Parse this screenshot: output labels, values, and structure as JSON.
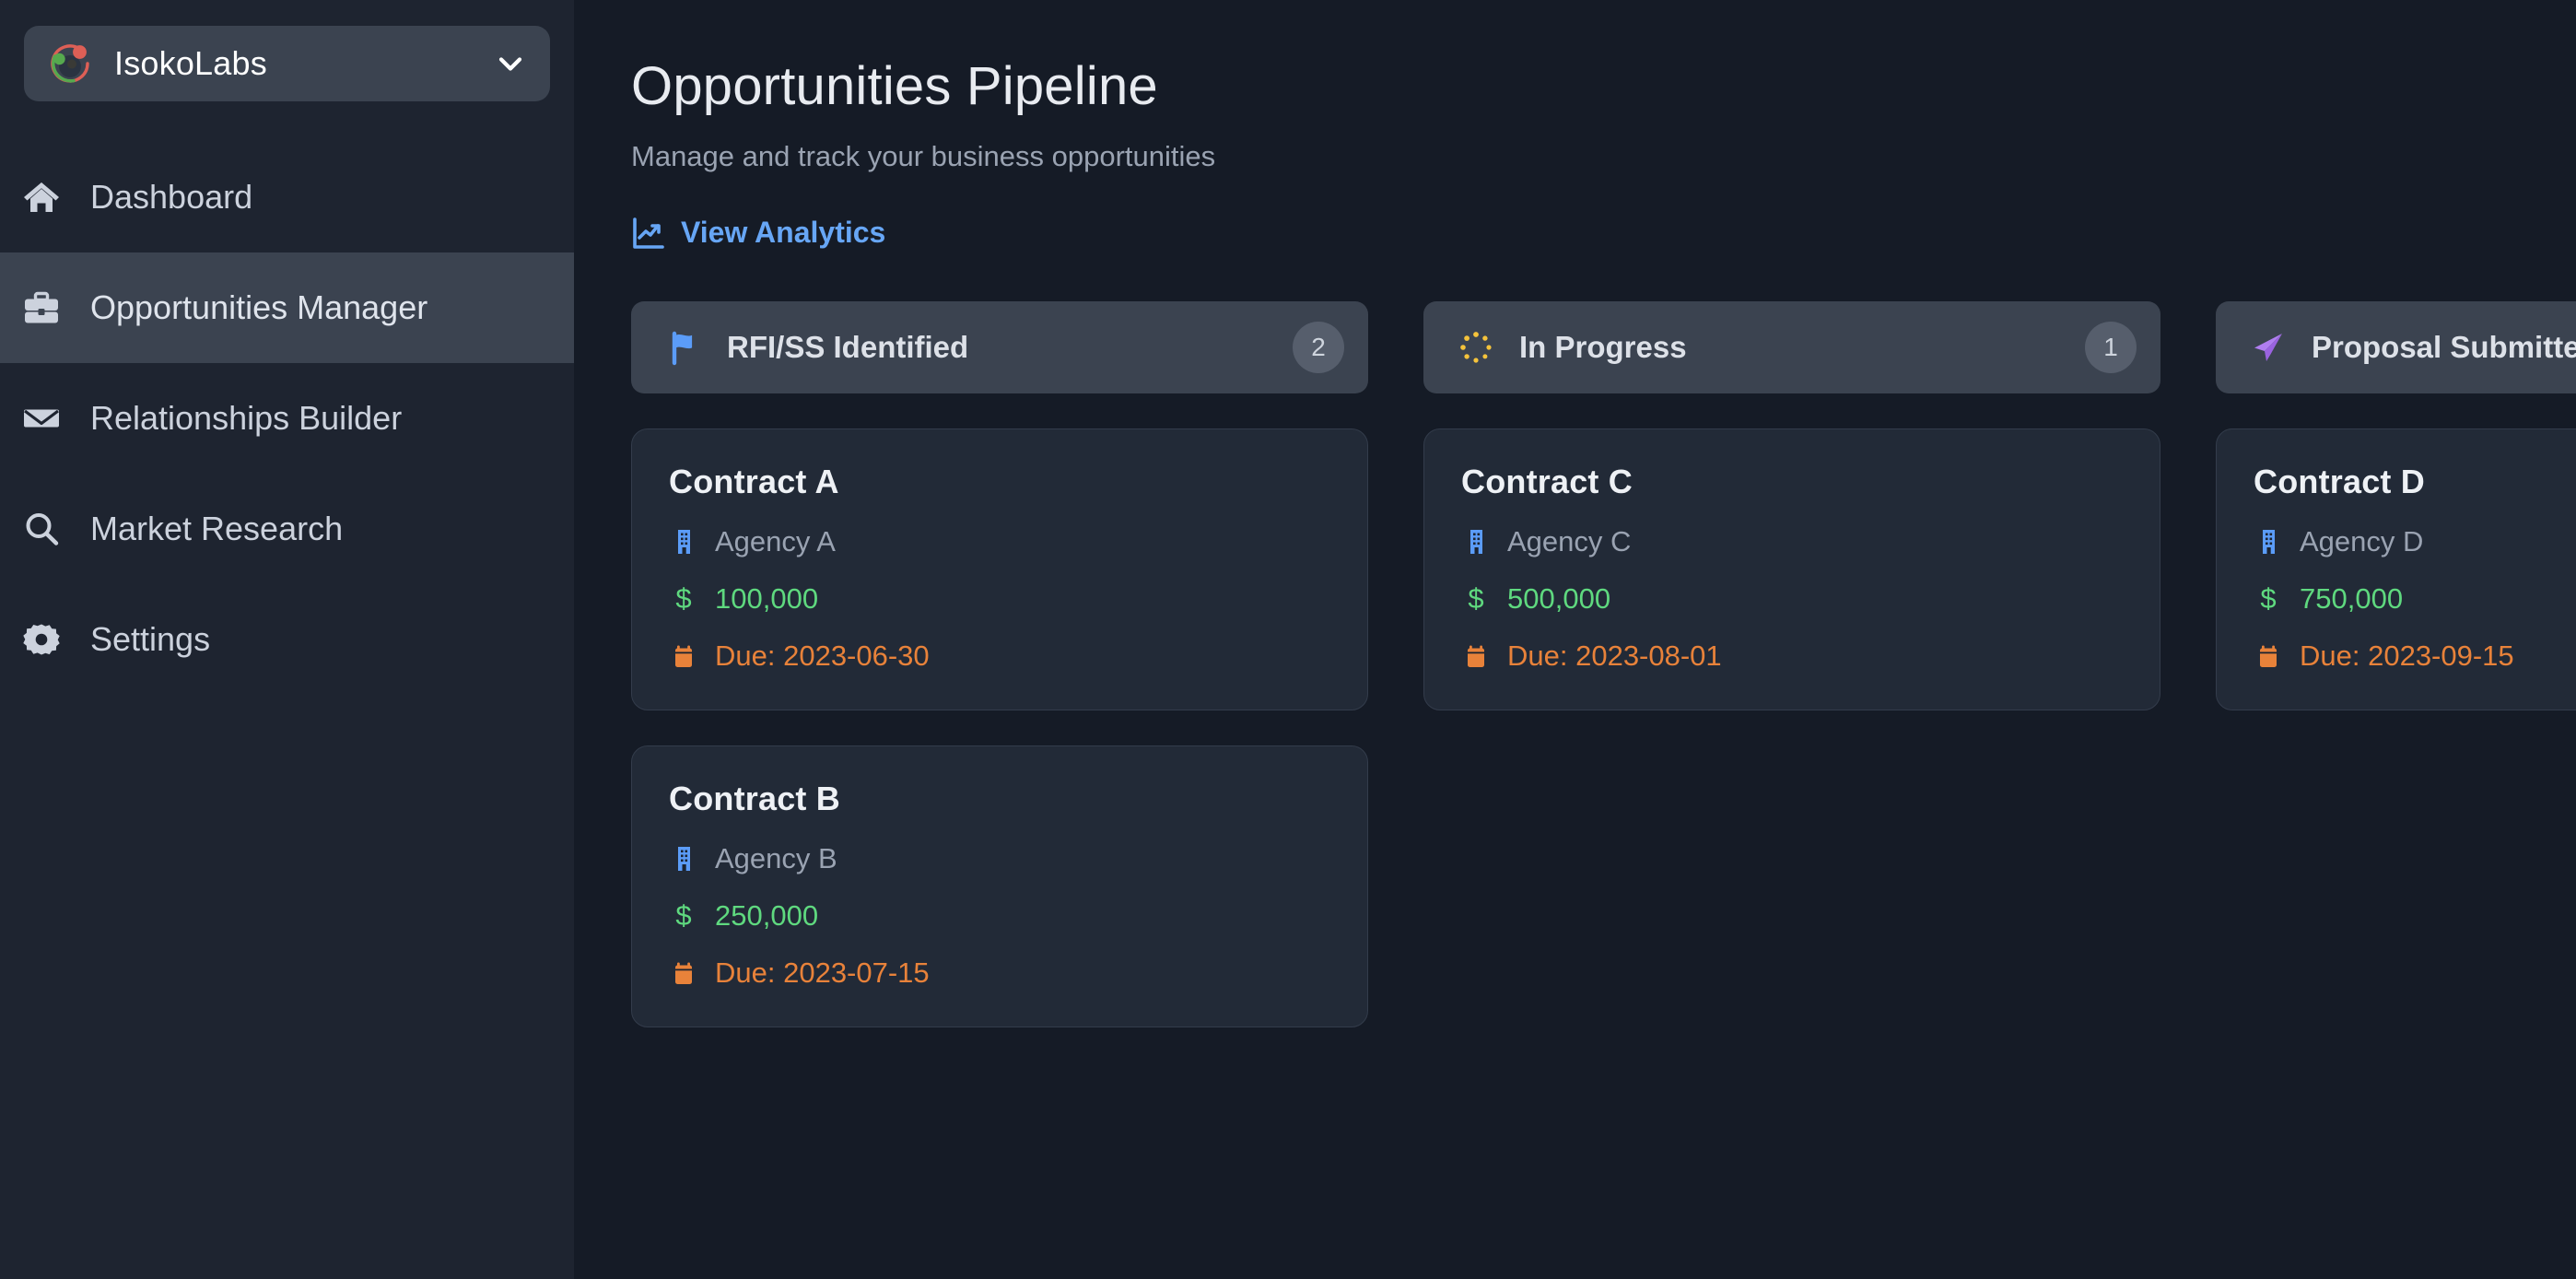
{
  "sidebar": {
    "org": {
      "name": "IsokoLabs",
      "logo_icon": "isokolabs-logo",
      "chevron_icon": "chevron-down-icon"
    },
    "items": [
      {
        "label": "Dashboard",
        "icon": "home-icon",
        "active": false
      },
      {
        "label": "Opportunities Manager",
        "icon": "briefcase-icon",
        "active": true
      },
      {
        "label": "Relationships Builder",
        "icon": "envelope-icon",
        "active": false
      },
      {
        "label": "Market Research",
        "icon": "search-icon",
        "active": false
      },
      {
        "label": "Settings",
        "icon": "gear-icon",
        "active": false
      }
    ]
  },
  "main": {
    "title": "Opportunities Pipeline",
    "subtitle": "Manage and track your business opportunities",
    "analytics_link": "View Analytics",
    "analytics_icon": "chart-line-up-icon"
  },
  "board": {
    "columns": [
      {
        "title": "RFI/SS Identified",
        "icon": "blue-flag-icon",
        "count": "2",
        "cards": [
          {
            "title": "Contract A",
            "agency": "Agency A",
            "amount": "100,000",
            "due": "Due: 2023-06-30"
          },
          {
            "title": "Contract B",
            "agency": "Agency B",
            "amount": "250,000",
            "due": "Due: 2023-07-15"
          }
        ]
      },
      {
        "title": "In Progress",
        "icon": "spinner-dots-icon",
        "count": "1",
        "cards": [
          {
            "title": "Contract C",
            "agency": "Agency C",
            "amount": "500,000",
            "due": "Due: 2023-08-01"
          }
        ]
      },
      {
        "title": "Proposal Submitted",
        "icon": "paper-plane-icon",
        "count": "",
        "cards": [
          {
            "title": "Contract D",
            "agency": "Agency D",
            "amount": "750,000",
            "due": "Due: 2023-09-15"
          }
        ]
      }
    ],
    "card_icons": {
      "agency": "building-icon",
      "amount": "dollar-icon",
      "due": "calendar-icon"
    },
    "money_glyph": "$"
  },
  "colors": {
    "sidebar_bg": "#1e2430",
    "main_bg": "#151b26",
    "active_nav_bg": "#3b4350",
    "card_bg": "#222a37",
    "accent_blue": "#67a6f5",
    "amount_green": "#5fd97f",
    "due_orange": "#e8823a",
    "flag_blue": "#5b9cf8",
    "spinner_yellow": "#f5c33b",
    "plane_purple": "#b07ef0"
  }
}
